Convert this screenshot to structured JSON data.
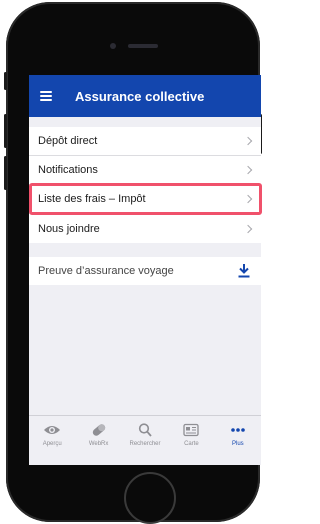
{
  "app": {
    "title": "Assurance collective"
  },
  "menu": {
    "items": [
      {
        "label": "Dépôt direct"
      },
      {
        "label": "Notifications"
      },
      {
        "label": "Liste des frais – Impôt"
      },
      {
        "label": "Nous joindre"
      }
    ]
  },
  "travel": {
    "label": "Preuve d’assurance voyage"
  },
  "tabs": [
    {
      "label": "Aperçu"
    },
    {
      "label": "WebRx"
    },
    {
      "label": "Rechercher"
    },
    {
      "label": "Carte"
    },
    {
      "label": "Plus"
    }
  ],
  "colors": {
    "brand": "#1346ae",
    "highlight": "#f0516b"
  }
}
